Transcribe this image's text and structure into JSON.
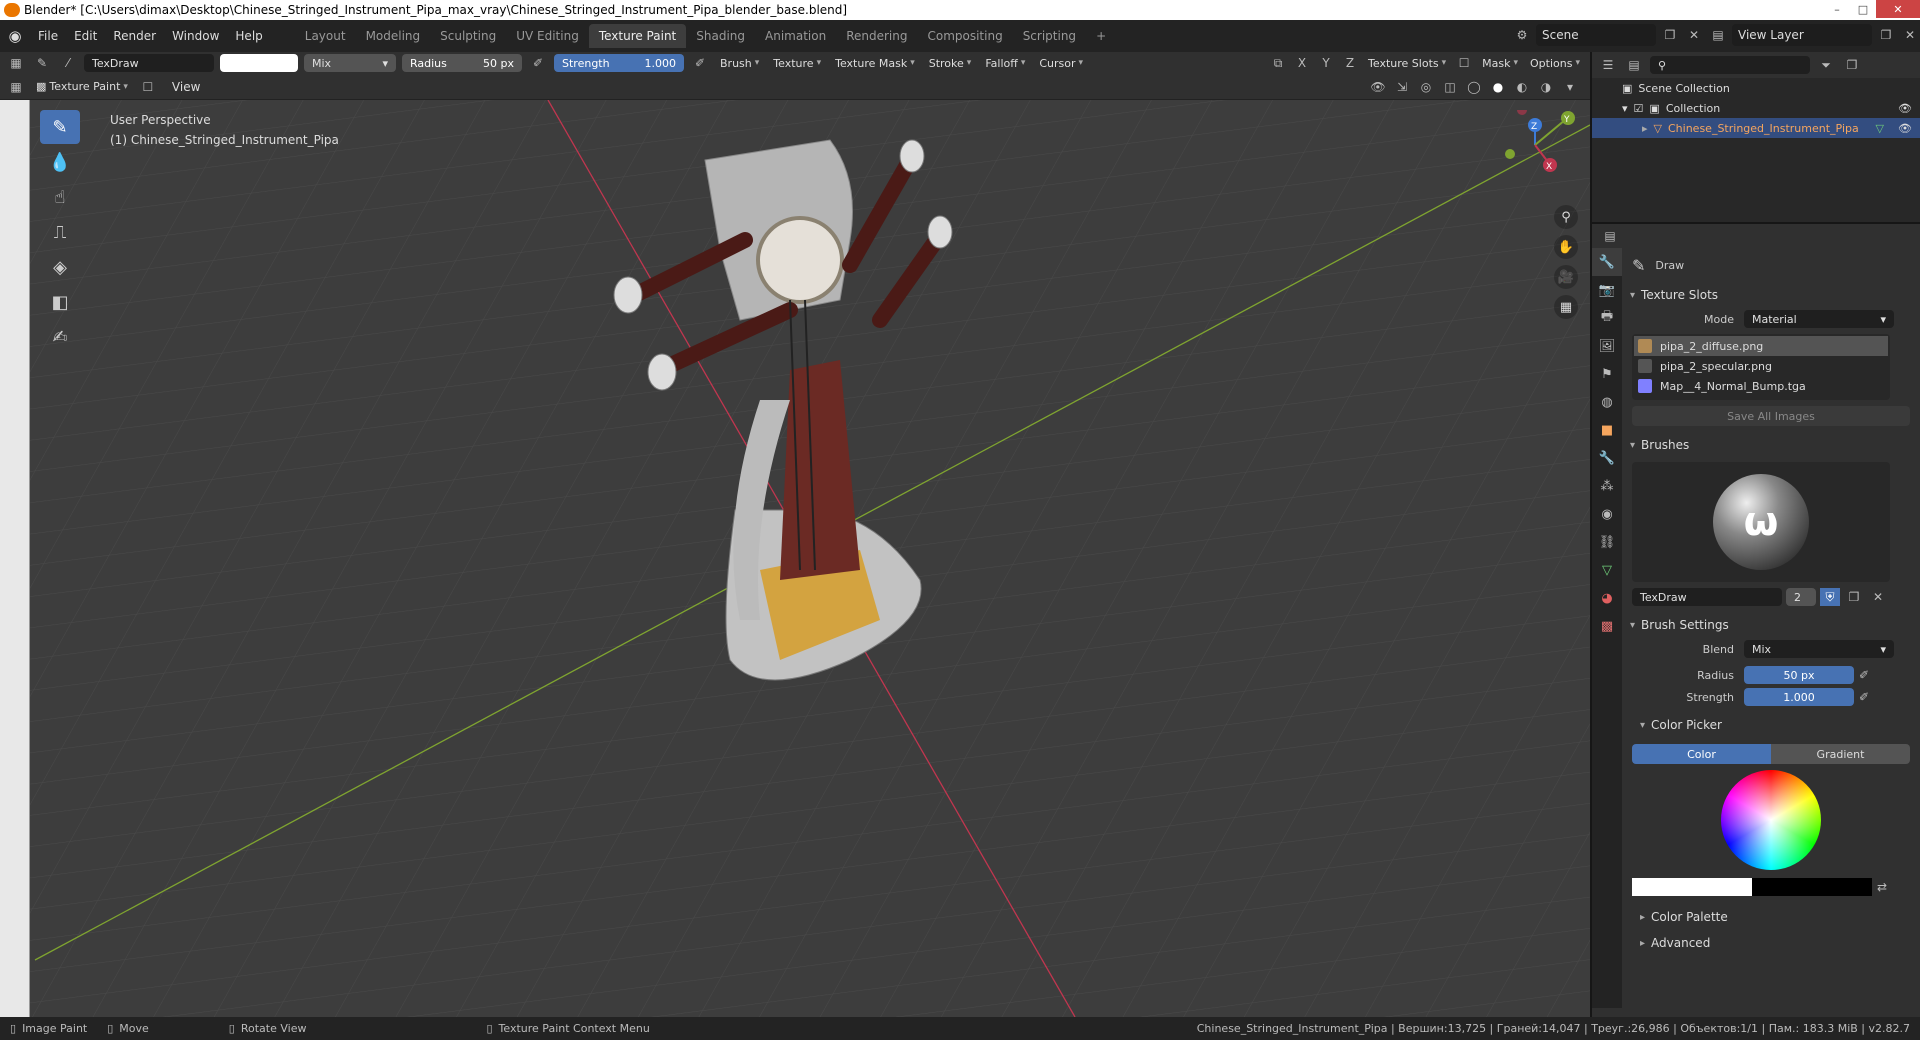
{
  "window": {
    "title": "Blender* [C:\\Users\\dimax\\Desktop\\Chinese_Stringed_Instrument_Pipa_max_vray\\Chinese_Stringed_Instrument_Pipa_blender_base.blend]",
    "controls": [
      "–",
      "□",
      "✕"
    ]
  },
  "menu": [
    "File",
    "Edit",
    "Render",
    "Window",
    "Help"
  ],
  "workspaces": [
    "Layout",
    "Modeling",
    "Sculpting",
    "UV Editing",
    "Texture Paint",
    "Shading",
    "Animation",
    "Rendering",
    "Compositing",
    "Scripting",
    "+"
  ],
  "active_workspace": "Texture Paint",
  "scene": {
    "label": "Scene",
    "view_layer": "View Layer"
  },
  "tool_header": {
    "brush_name": "TexDraw",
    "blend": "Mix",
    "radius_label": "Radius",
    "radius_value": "50 px",
    "strength_label": "Strength",
    "strength_value": "1.000",
    "menus": [
      "Brush",
      "Texture",
      "Texture Mask",
      "Stroke",
      "Falloff",
      "Cursor"
    ],
    "axes": [
      "X",
      "Y",
      "Z"
    ],
    "right_menus": [
      "Texture Slots",
      "Mask",
      "Options"
    ]
  },
  "viewport_header": {
    "mode": "Texture Paint",
    "view_menu": "View"
  },
  "viewport": {
    "perspective": "User Perspective",
    "object": "(1) Chinese_Stringed_Instrument_Pipa",
    "gizmo_axes": [
      "Z",
      "Y",
      "X"
    ]
  },
  "outliner": {
    "scene_collection": "Scene Collection",
    "collection": "Collection",
    "object": "Chinese_Stringed_Instrument_Pipa"
  },
  "properties": {
    "tool_name": "Draw",
    "texture_slots": {
      "title": "Texture Slots",
      "mode_label": "Mode",
      "mode_value": "Material",
      "slots": [
        {
          "name": "pipa_2_diffuse.png",
          "color": "#b08a55"
        },
        {
          "name": "pipa_2_specular.png",
          "color": "#555555"
        },
        {
          "name": "Map__4_Normal_Bump.tga",
          "color": "#8080ff"
        }
      ],
      "save_all": "Save All Images"
    },
    "brushes": {
      "title": "Brushes",
      "name": "TexDraw",
      "users": "2"
    },
    "brush_settings": {
      "title": "Brush Settings",
      "blend_label": "Blend",
      "blend_value": "Mix",
      "radius_label": "Radius",
      "radius_value": "50 px",
      "strength_label": "Strength",
      "strength_value": "1.000"
    },
    "color_picker": {
      "title": "Color Picker",
      "tabs": [
        "Color",
        "Gradient"
      ]
    },
    "color_palette": "Color Palette",
    "advanced": "Advanced"
  },
  "statusbar": {
    "items": [
      "Image Paint",
      "Move",
      "Rotate View",
      "Texture Paint Context Menu"
    ],
    "stats": "Chinese_Stringed_Instrument_Pipa | Вершин:13,725 | Граней:14,047 | Треуг.:26,986 | Объектов:1/1 | Пам.: 183.3 MiB | v2.82.7"
  },
  "colors": {
    "accent": "#4772b3",
    "x_axis": "#c0364f",
    "y_axis": "#7fa430",
    "z_axis": "#3d7bd8"
  }
}
